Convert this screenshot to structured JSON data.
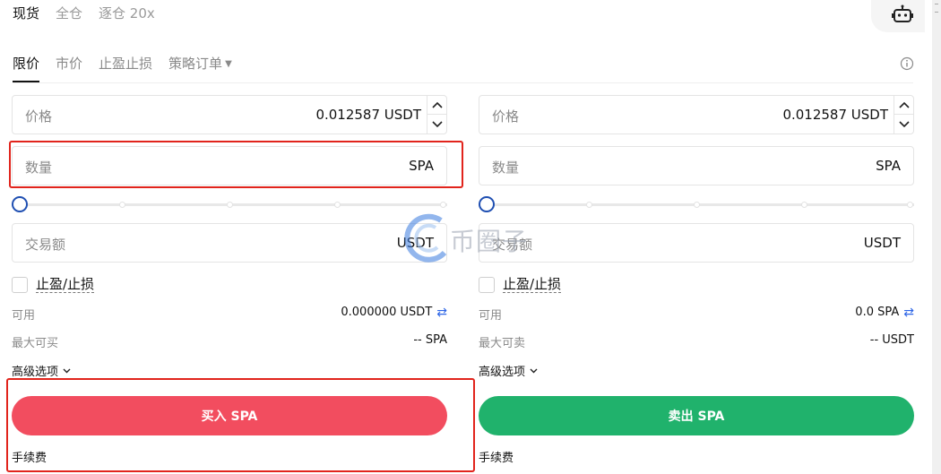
{
  "top_tabs": [
    {
      "label": "现货",
      "active": true
    },
    {
      "label": "全仓",
      "active": false
    },
    {
      "label": "逐仓 20x",
      "active": false
    }
  ],
  "order_tabs": [
    {
      "label": "限价",
      "active": true
    },
    {
      "label": "市价",
      "active": false
    },
    {
      "label": "止盈止损",
      "active": false
    },
    {
      "label": "策略订单",
      "active": false
    }
  ],
  "buy": {
    "price": {
      "label": "价格",
      "value": "0.012587 USDT"
    },
    "quantity": {
      "label": "数量",
      "value": "SPA"
    },
    "amount": {
      "label": "交易额",
      "value": "USDT"
    },
    "slider_percent": 0,
    "tpsl_label": "止盈/止损",
    "available": {
      "label": "可用",
      "value": "0.000000 USDT"
    },
    "max": {
      "label": "最大可买",
      "value": "-- SPA"
    },
    "advanced": "高级选项",
    "button": "买入 SPA",
    "fee": "手续费"
  },
  "sell": {
    "price": {
      "label": "价格",
      "value": "0.012587 USDT"
    },
    "quantity": {
      "label": "数量",
      "value": "SPA"
    },
    "amount": {
      "label": "交易额",
      "value": "USDT"
    },
    "slider_percent": 0,
    "tpsl_label": "止盈/止损",
    "available": {
      "label": "可用",
      "value": "0.0 SPA"
    },
    "max": {
      "label": "最大可卖",
      "value": "-- USDT"
    },
    "advanced": "高级选项",
    "button": "卖出 SPA",
    "fee": "手续费"
  },
  "watermark_text": "币圈子",
  "colors": {
    "buy": "#f24d5f",
    "sell": "#20b26c",
    "highlight": "#e1241c",
    "slider_knob": "#1f4fb2",
    "link": "#2d65e6"
  },
  "icons": [
    "robot-icon",
    "info-icon",
    "chevron-up-icon",
    "chevron-down-icon",
    "swap-icon",
    "caret-down-icon"
  ]
}
